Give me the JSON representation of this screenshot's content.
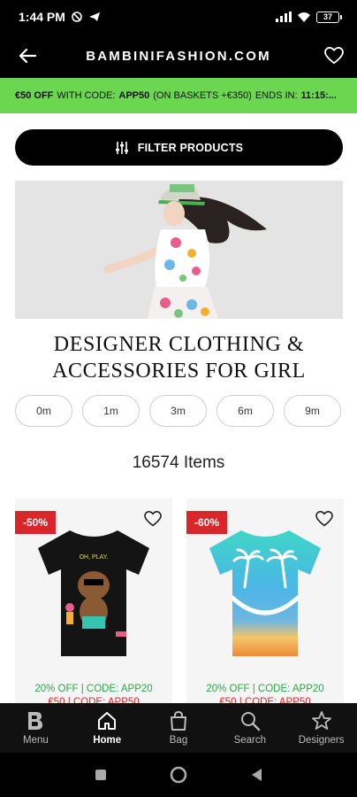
{
  "status": {
    "time": "1:44 PM",
    "battery": "37"
  },
  "header": {
    "title": "BAMBINIFASHION.COM"
  },
  "promo": {
    "discount": "€50 OFF",
    "text_with": "WITH CODE:",
    "code": "APP50",
    "condition": "(ON BASKETS +€350)",
    "ends": "ENDS IN:",
    "timer": "11:15:..."
  },
  "filter": {
    "label": "FILTER PRODUCTS"
  },
  "page": {
    "title": "DESIGNER CLOTHING & ACCESSORIES FOR GIRL",
    "item_count": "16574 Items"
  },
  "age_filters": [
    "0m",
    "1m",
    "3m",
    "6m",
    "9m"
  ],
  "products": [
    {
      "discount": "-50%",
      "promo_line": "20% OFF | CODE: APP20",
      "promo_line2": "€50 | CODE: APP50",
      "print_text": "OH, PLAY."
    },
    {
      "discount": "-60%",
      "promo_line": "20% OFF | CODE: APP20",
      "promo_line2": "€50 | CODE: APP50"
    }
  ],
  "bottom_nav": [
    {
      "label": "Menu",
      "icon": "bambini-logo-icon",
      "active": false
    },
    {
      "label": "Home",
      "icon": "home-icon",
      "active": true
    },
    {
      "label": "Bag",
      "icon": "bag-icon",
      "active": false
    },
    {
      "label": "Search",
      "icon": "search-icon",
      "active": false
    },
    {
      "label": "Designers",
      "icon": "star-icon",
      "active": false
    }
  ],
  "colors": {
    "promo_bar": "#6bd64f",
    "discount_badge": "#d9262b",
    "promo_code_green": "#28a745"
  }
}
